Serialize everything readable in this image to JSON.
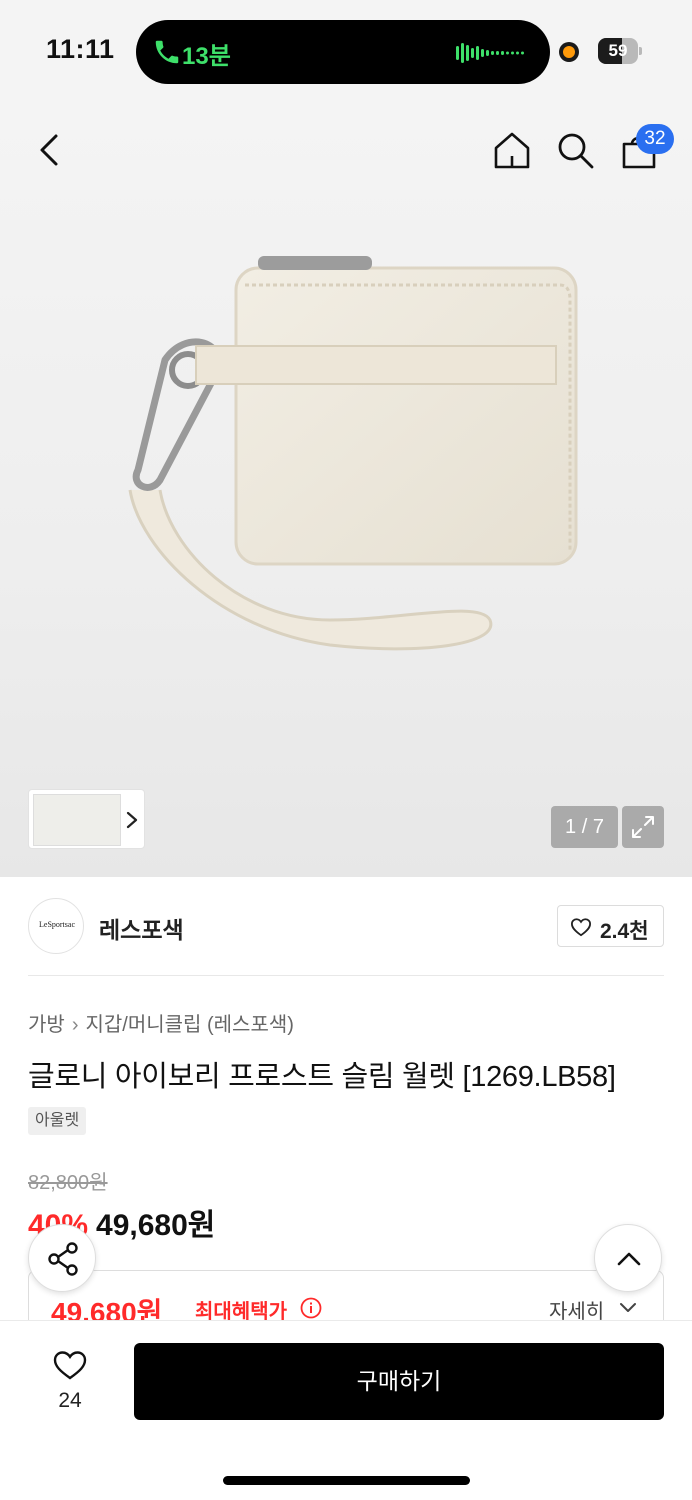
{
  "status_bar": {
    "time": "11:11",
    "call_duration": "13분",
    "battery_level": "59",
    "battery_fraction": 0.59
  },
  "header": {
    "cart_count": "32"
  },
  "gallery": {
    "counter": "1 / 7"
  },
  "brand": {
    "logo_text": "LeSportsac",
    "name": "레스포색",
    "like_count": "2.4천"
  },
  "breadcrumb": {
    "category": "가방",
    "subcategory": "지갑/머니클립 (레스포색)"
  },
  "product": {
    "title": "글로니 아이보리 프로스트 슬림 월렛 [1269.LB58]",
    "tag": "아울렛",
    "original_price": "82,800원",
    "discount": "40%",
    "sale_price": "49,680원"
  },
  "benefit": {
    "price": "49,680원",
    "label": "최대혜택가",
    "detail_label": "자세히"
  },
  "bottom_bar": {
    "wish_count": "24",
    "buy_label": "구매하기"
  },
  "colors": {
    "accent_red": "#ff2a2a",
    "badge_blue": "#2a6ff0",
    "call_green": "#3ee06a",
    "buy_button": "#000000"
  }
}
